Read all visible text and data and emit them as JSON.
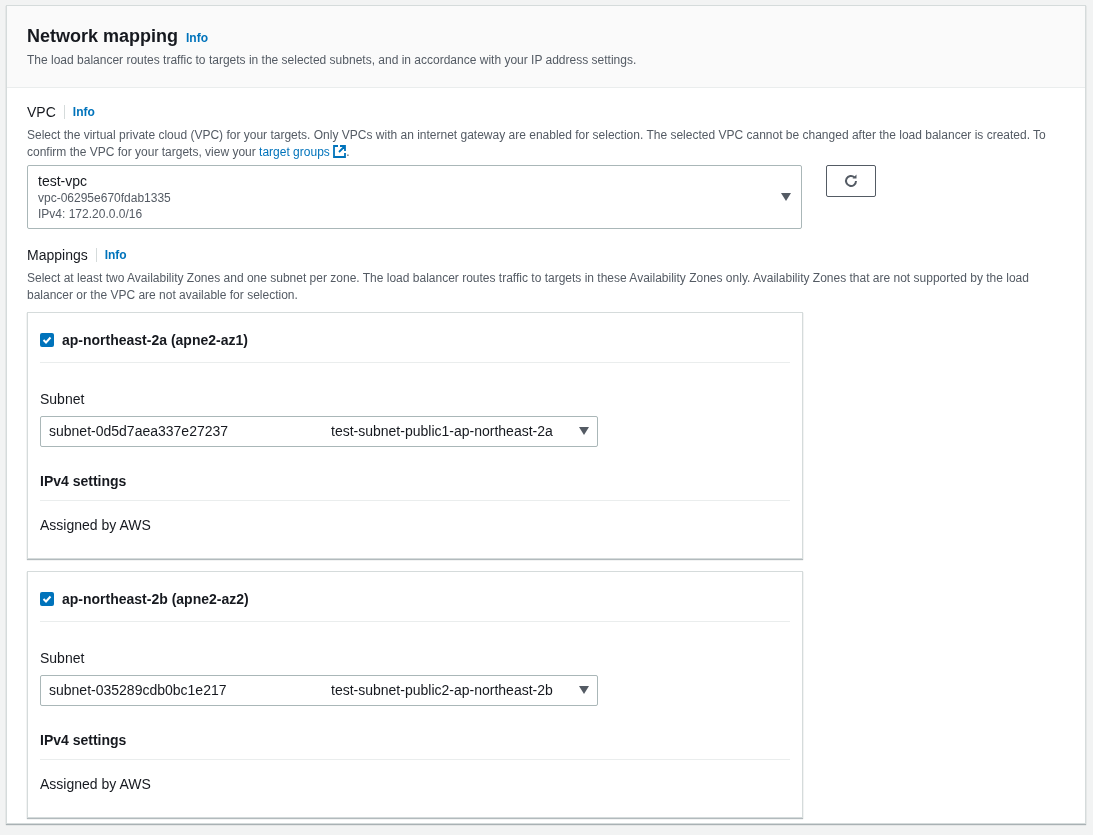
{
  "header": {
    "title": "Network mapping",
    "info": "Info",
    "description": "The load balancer routes traffic to targets in the selected subnets, and in accordance with your IP address settings."
  },
  "vpc": {
    "label": "VPC",
    "info": "Info",
    "description": "Select the virtual private cloud (VPC) for your targets. Only VPCs with an internet gateway are enabled for selection. The selected VPC cannot be changed after the load balancer is created. To confirm the VPC for your targets, view your",
    "link": "target groups",
    "suffix": ".",
    "select": {
      "name": "test-vpc",
      "id": "vpc-06295e670fdab1335",
      "cidr": "IPv4: 172.20.0.0/16"
    }
  },
  "mappings": {
    "label": "Mappings",
    "info": "Info",
    "description": "Select at least two Availability Zones and one subnet per zone. The load balancer routes traffic to targets in these Availability Zones only. Availability Zones that are not supported by the load balancer or the VPC are not available for selection.",
    "zones": [
      {
        "name": "ap-northeast-2a (apne2-az1)",
        "checked": true,
        "subnet_label": "Subnet",
        "subnet_id": "subnet-0d5d7aea337e27237",
        "subnet_name": "test-subnet-public1-ap-northeast-2a",
        "ipv4_title": "IPv4 settings",
        "ipv4_value": "Assigned by AWS"
      },
      {
        "name": "ap-northeast-2b (apne2-az2)",
        "checked": true,
        "subnet_label": "Subnet",
        "subnet_id": "subnet-035289cdb0bc1e217",
        "subnet_name": "test-subnet-public2-ap-northeast-2b",
        "ipv4_title": "IPv4 settings",
        "ipv4_value": "Assigned by AWS"
      }
    ]
  }
}
